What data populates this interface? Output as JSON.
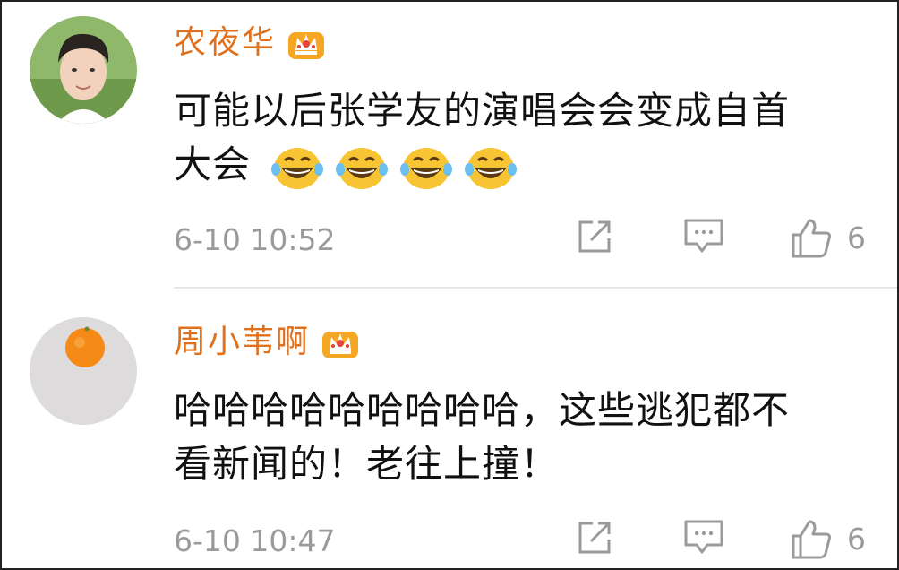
{
  "comments": [
    {
      "username": "农夜华",
      "badge_icon": "crown-icon",
      "text_line1": "可能以后张学友的演唱会会变成自首",
      "text_line2": "大会",
      "emojis": [
        "laughing-tears-emoji",
        "laughing-tears-emoji",
        "laughing-tears-emoji",
        "laughing-tears-emoji"
      ],
      "timestamp": "6-10 10:52",
      "like_count": "6"
    },
    {
      "username": "周小苇啊",
      "badge_icon": "crown-icon",
      "text_line1": "哈哈哈哈哈哈哈哈哈，这些逃犯都不",
      "text_line2": "看新闻的！老往上撞！",
      "timestamp": "6-10 10:47",
      "like_count": "6"
    }
  ],
  "colors": {
    "username": "#e0711c",
    "text": "#111111",
    "meta": "#9a9a9a",
    "crown": "#f5a623"
  }
}
